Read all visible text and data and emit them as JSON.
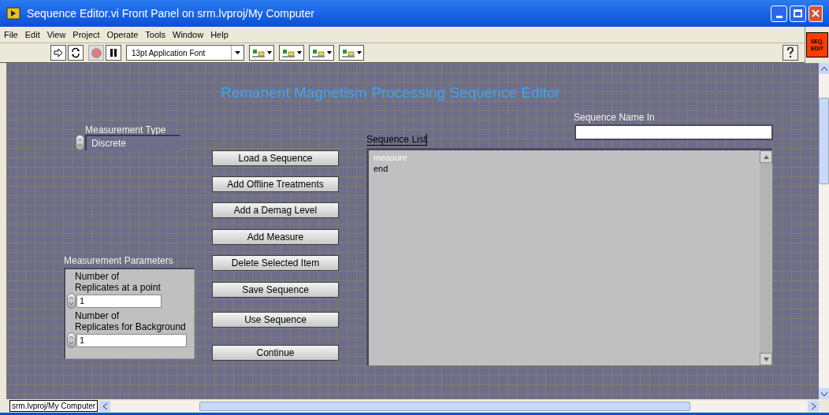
{
  "window": {
    "title": "Sequence Editor.vi Front Panel on srm.lvproj/My Computer"
  },
  "menu": [
    "File",
    "Edit",
    "View",
    "Project",
    "Operate",
    "Tools",
    "Window",
    "Help"
  ],
  "toolbar": {
    "font": "13pt Application Font",
    "run_disabled": true
  },
  "vi_icon": {
    "lines": [
      "SEQ.",
      "EDIT"
    ]
  },
  "panel": {
    "heading": "Remanent Magnetism Processing Sequence Editor",
    "measurement_type": {
      "label": "Measurement Type",
      "value": "Discrete"
    },
    "buttons": [
      "Load a Sequence",
      "Add Offline Treatments",
      "Add a Demag Level",
      "Add Measure",
      "Delete Selected Item",
      "Save Sequence",
      "Use Sequence",
      "Continue"
    ],
    "parameters": {
      "label": "Measurement Parameters",
      "fields": [
        {
          "label_lines": [
            "Number of",
            "Replicates at a point"
          ],
          "value": "1"
        },
        {
          "label_lines": [
            "Number of",
            "Replicates for Background"
          ],
          "value": "1"
        }
      ]
    },
    "sequence_name": {
      "label": "Sequence Name In"
    },
    "sequence_list": {
      "label": "Sequence List",
      "items": [
        {
          "text": "measure",
          "selected": true
        },
        {
          "text": "end",
          "selected": false
        }
      ]
    }
  },
  "status_bar": {
    "context": "srm.lvproj/My Computer"
  }
}
